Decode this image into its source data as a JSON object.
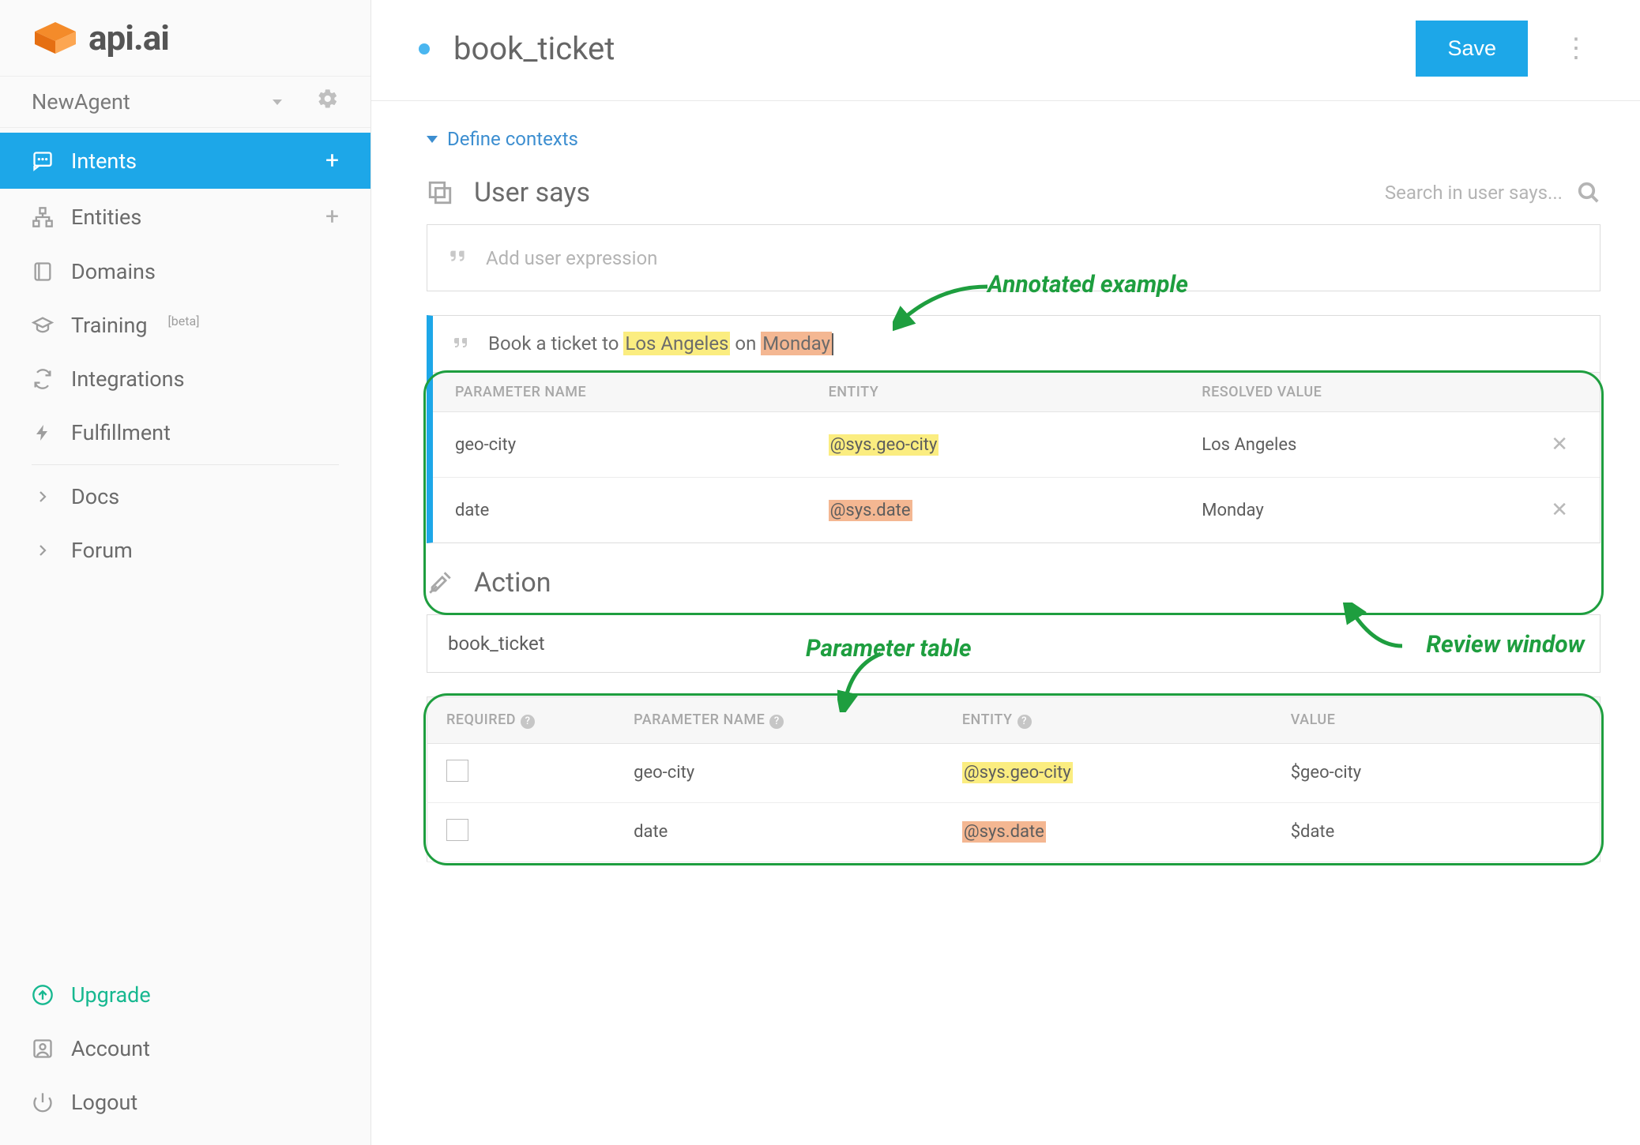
{
  "brand": "api.ai",
  "agent_name": "NewAgent",
  "sidebar": {
    "items": [
      {
        "label": "Intents",
        "has_add": true,
        "active": true
      },
      {
        "label": "Entities",
        "has_add": true
      },
      {
        "label": "Domains"
      },
      {
        "label": "Training",
        "beta": "[beta]"
      },
      {
        "label": "Integrations"
      },
      {
        "label": "Fulfillment"
      }
    ],
    "links": [
      {
        "label": "Docs"
      },
      {
        "label": "Forum"
      }
    ],
    "bottom": {
      "upgrade": "Upgrade",
      "account": "Account",
      "logout": "Logout"
    }
  },
  "topbar": {
    "title": "book_ticket",
    "save": "Save"
  },
  "contexts_link": "Define contexts",
  "user_says": {
    "title": "User says",
    "search_placeholder": "Search in user says...",
    "add_placeholder": "Add user expression",
    "example": {
      "prefix": "Book a ticket to ",
      "city": "Los Angeles",
      "mid": " on ",
      "day": "Monday"
    },
    "columns": {
      "param": "PARAMETER NAME",
      "entity": "ENTITY",
      "resolved": "RESOLVED VALUE"
    },
    "rows": [
      {
        "name": "geo-city",
        "entity": "@sys.geo-city",
        "resolved": "Los Angeles",
        "hl": "hl-yellow"
      },
      {
        "name": "date",
        "entity": "@sys.date",
        "resolved": "Monday",
        "hl": "hl-orange"
      }
    ]
  },
  "action": {
    "title": "Action",
    "name": "book_ticket",
    "columns": {
      "required": "REQUIRED",
      "param": "PARAMETER NAME",
      "entity": "ENTITY",
      "value": "VALUE"
    },
    "rows": [
      {
        "name": "geo-city",
        "entity": "@sys.geo-city",
        "value": "$geo-city",
        "hl": "hl-yellow"
      },
      {
        "name": "date",
        "entity": "@sys.date",
        "value": "$date",
        "hl": "hl-orange"
      }
    ]
  },
  "annotations": {
    "annotated_example": "Annotated example",
    "review_window": "Review window",
    "parameter_table": "Parameter table"
  }
}
